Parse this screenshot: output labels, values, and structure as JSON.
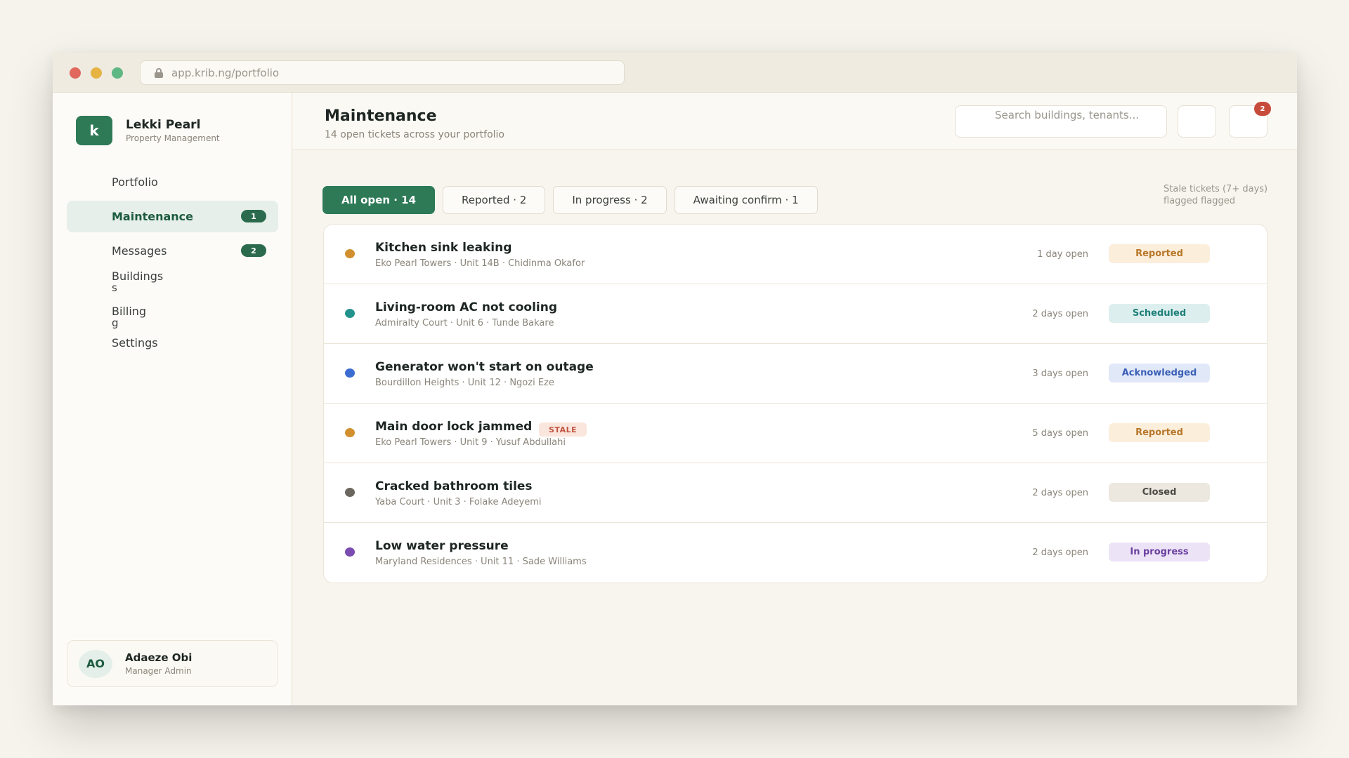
{
  "browser": {
    "url": "app.krib.ng/portfolio"
  },
  "brand": {
    "logo_letter": "k",
    "name": "Lekki Pearl",
    "subtitle": "Property Management"
  },
  "nav": [
    {
      "label": "Portfolio",
      "badge": ""
    },
    {
      "label": "Maintenance",
      "badge": "1"
    },
    {
      "label": "Messages",
      "badge": "2"
    },
    {
      "label": "Buildings",
      "extra": "s"
    },
    {
      "label": "Billing",
      "extra": "g"
    },
    {
      "label": "Settings"
    }
  ],
  "user": {
    "initials": "AO",
    "name": "Adaeze Obi",
    "role": "Manager Admin"
  },
  "header": {
    "title": "Maintenance",
    "subtitle": "14 open tickets across your portfolio",
    "search_placeholder": "Search buildings, tenants...",
    "notification_count": "2"
  },
  "filters": [
    {
      "label": "All open · 14",
      "active": true
    },
    {
      "label": "Reported · 2",
      "active": false
    },
    {
      "label": "In progress · 2",
      "active": false
    },
    {
      "label": "Awaiting confirm · 1",
      "active": false
    }
  ],
  "stale_note": "Stale tickets (7+ days) flagged flagged",
  "tickets": [
    {
      "title": "Kitchen sink leaking",
      "meta": "Eko Pearl Towers · Unit 14B · Chidinma Okafor",
      "age": "1 day open",
      "status": "Reported",
      "dot_color": "#d18f2f",
      "status_bg": "#fbeedb",
      "status_fg": "#b7772a",
      "stale": ""
    },
    {
      "title": "Living-room AC not cooling",
      "meta": "Admiralty Court · Unit 6 · Tunde Bakare",
      "age": "2 days open",
      "status": "Scheduled",
      "dot_color": "#23918c",
      "status_bg": "#dcefee",
      "status_fg": "#1f7f79",
      "stale": ""
    },
    {
      "title": "Generator won't start on outage",
      "meta": "Bourdillon Heights · Unit 12 · Ngozi Eze",
      "age": "3 days open",
      "status": "Acknowledged",
      "dot_color": "#3b6dd1",
      "status_bg": "#e1e8f8",
      "status_fg": "#3a60b6",
      "stale": ""
    },
    {
      "title": "Main door lock jammed",
      "meta": "Eko Pearl Towers · Unit 9 · Yusuf Abdullahi",
      "age": "5 days open",
      "status": "Reported",
      "dot_color": "#d18f2f",
      "status_bg": "#fbeedb",
      "status_fg": "#b7772a",
      "stale": "STALE"
    },
    {
      "title": "Cracked bathroom tiles",
      "meta": "Yaba Court · Unit 3 · Folake Adeyemi",
      "age": "2 days open",
      "status": "Closed",
      "dot_color": "#6b675e",
      "status_bg": "#ece8df",
      "status_fg": "#4d4a44",
      "stale": ""
    },
    {
      "title": "Low water pressure",
      "meta": "Maryland Residences · Unit 11 · Sade Williams",
      "age": "2 days open",
      "status": "In progress",
      "dot_color": "#7a4bb0",
      "status_bg": "#ece4f6",
      "status_fg": "#6a3fa0",
      "stale": ""
    }
  ]
}
